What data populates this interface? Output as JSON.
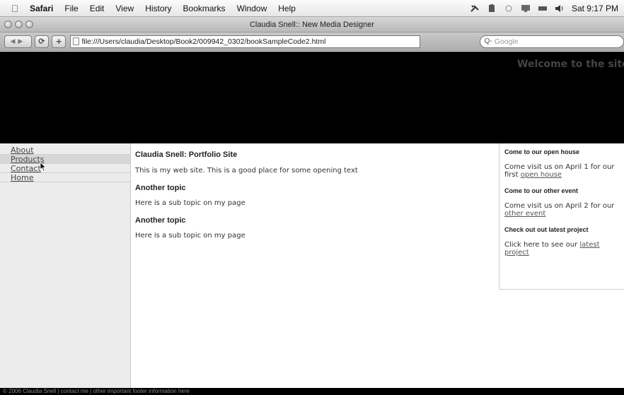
{
  "menubar": {
    "app_name": "Safari",
    "items": [
      "File",
      "Edit",
      "View",
      "History",
      "Bookmarks",
      "Window",
      "Help"
    ],
    "clock": "Sat 9:17 PM"
  },
  "window": {
    "title": "Claudia Snell:: New Media Designer"
  },
  "toolbar": {
    "url": "file:///Users/claudia/Desktop/Book2/009942_0302/bookSampleCode2.html",
    "search_placeholder": "Google"
  },
  "page": {
    "banner_text": "Welcome to the site",
    "nav": [
      "About",
      "Products",
      "Contact",
      "Home"
    ],
    "main": {
      "title": "Claudia Snell: Portfolio Site",
      "intro": "This is my web site. This is a good place for some opening text",
      "topics": [
        {
          "heading": "Another topic",
          "text": "Here is a sub topic on my page"
        },
        {
          "heading": "Another topic",
          "text": "Here is a sub topic on my page"
        }
      ]
    },
    "aside": [
      {
        "heading": "Come to our open house",
        "text": "Come visit us on April 1 for our first ",
        "link": "open house"
      },
      {
        "heading": "Come to our other event",
        "text": "Come visit us on April 2 for our ",
        "link": "other event"
      },
      {
        "heading": "Check out out latest project",
        "text": "Click here to see our ",
        "link": "latest project"
      }
    ],
    "footer": "© 2006 Claudia Snell | contact me | other important footer information here"
  }
}
